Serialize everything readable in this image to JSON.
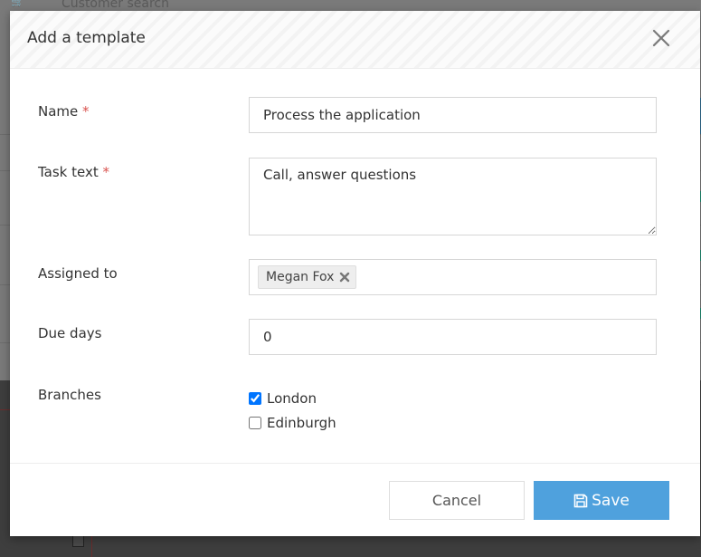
{
  "background": {
    "search_label": "Customer search"
  },
  "modal": {
    "title": "Add a template",
    "fields": {
      "name": {
        "label": "Name",
        "required_mark": "*",
        "value": "Process the application"
      },
      "task_text": {
        "label": "Task text",
        "required_mark": "*",
        "value": "Call, answer questions"
      },
      "assigned_to": {
        "label": "Assigned to",
        "tags": [
          "Megan Fox"
        ]
      },
      "due_days": {
        "label": "Due days",
        "value": "0"
      },
      "branches": {
        "label": "Branches",
        "options": [
          {
            "label": "London",
            "checked": true
          },
          {
            "label": "Edinburgh",
            "checked": false
          }
        ]
      }
    },
    "footer": {
      "cancel_label": "Cancel",
      "save_label": "Save"
    }
  },
  "colors": {
    "accent": "#4fa1dd",
    "required": "#d9534f"
  },
  "icons": {
    "close": "close-icon",
    "tag_remove": "remove-tag-icon",
    "save": "floppy-disk-icon"
  }
}
